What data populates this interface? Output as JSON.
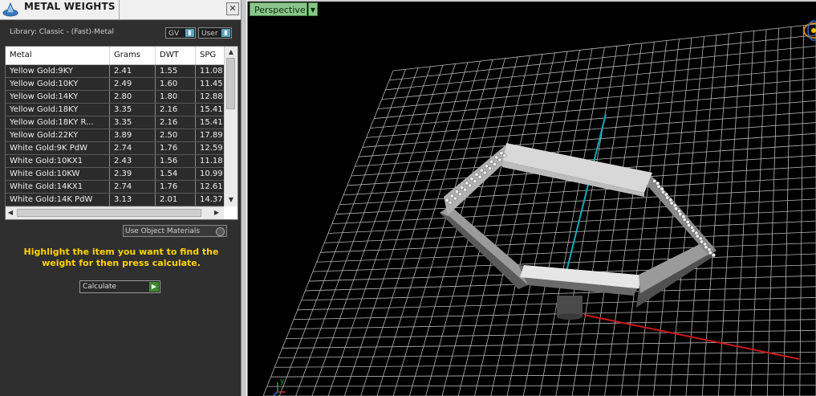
{
  "panel": {
    "title": "METAL WEIGHTS",
    "close_label": "✕",
    "library_label": "Library: Classic - (Fast)-Metal",
    "combo_gv": "GV",
    "combo_user": "User",
    "use_object_materials": "Use Object Materials",
    "instruction": "Highlight the item you want to find the weight for then press calculate.",
    "calculate_label": "Calculate"
  },
  "table": {
    "headers": [
      "Metal",
      "Grams",
      "DWT",
      "SPG"
    ],
    "rows": [
      [
        "Yellow Gold:9KY",
        "2.41",
        "1.55",
        "11.08"
      ],
      [
        "Yellow Gold:10KY",
        "2.49",
        "1.60",
        "11.45"
      ],
      [
        "Yellow Gold:14KY",
        "2.80",
        "1.80",
        "12.88"
      ],
      [
        "Yellow Gold:18KY",
        "3.35",
        "2.16",
        "15.41"
      ],
      [
        "Yellow Gold:18KY R...",
        "3.35",
        "2.16",
        "15.41"
      ],
      [
        "Yellow Gold:22KY",
        "3.89",
        "2.50",
        "17.89"
      ],
      [
        "White Gold:9K PdW",
        "2.74",
        "1.76",
        "12.59"
      ],
      [
        "White Gold:10KX1",
        "2.43",
        "1.56",
        "11.18"
      ],
      [
        "White Gold:10KW",
        "2.39",
        "1.54",
        "10.99"
      ],
      [
        "White Gold:14KX1",
        "2.74",
        "1.76",
        "12.61"
      ],
      [
        "White Gold:14K PdW",
        "3.13",
        "2.01",
        "14.37"
      ]
    ]
  },
  "viewport": {
    "tab_label": "Perspective",
    "axis_label_y": "y"
  },
  "colors": {
    "instruction": "#ffd400",
    "viewport_tab": "#8bc58b",
    "x_axis": "#cc1a1a",
    "y_axis": "#1aa8b8",
    "grid": "#b5b5b5"
  }
}
